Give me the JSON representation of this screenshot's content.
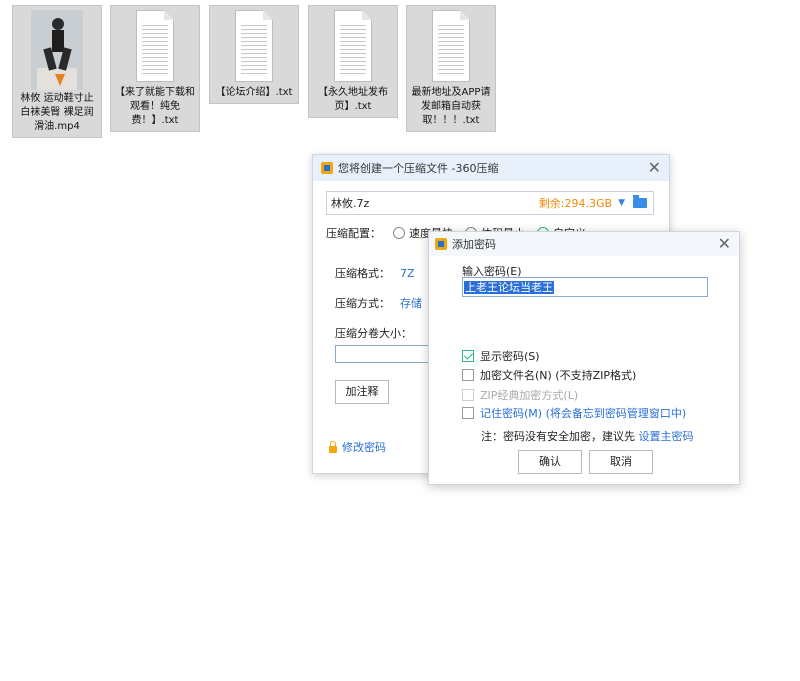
{
  "desktop": {
    "files": [
      {
        "name": "林攸 运动鞋寸止白袜美臀 裸足润滑油.mp4",
        "kind": "video"
      },
      {
        "name": "【来了就能下载和观看！纯免费！】.txt",
        "kind": "text"
      },
      {
        "name": "【论坛介绍】.txt",
        "kind": "text"
      },
      {
        "name": "【永久地址发布页】.txt",
        "kind": "text"
      },
      {
        "name": "最新地址及APP请发邮箱自动获取！！！.txt",
        "kind": "text"
      }
    ]
  },
  "compress_window": {
    "title": "您将创建一个压缩文件 -360压缩",
    "archive_name": "林攸.7z",
    "free_space": "剩余:294.3GB",
    "config_label": "压缩配置：",
    "config_options": [
      "速度最快",
      "体积最小",
      "自定义"
    ],
    "format_label": "压缩格式：",
    "format_value": "7Z",
    "method_label": "压缩方式：",
    "method_value": "存储",
    "split_label": "压缩分卷大小：",
    "comment_button": "加注释",
    "change_password": "修改密码"
  },
  "password_dialog": {
    "title": "添加密码",
    "input_label": "输入密码(E)",
    "password_value": "上老王论坛当老王",
    "options": {
      "show_password": "显示密码(S)",
      "encrypt_filenames": "加密文件名(N) (不支持ZIP格式)",
      "zip_classic": "ZIP经典加密方式(L)",
      "remember_password": "记住密码(M) (将会备忘到密码管理窗口中)"
    },
    "note_prefix": "注：密码没有安全加密，建议先",
    "note_link": "设置主密码",
    "ok_button": "确认",
    "cancel_button": "取消"
  },
  "colors": {
    "accent": "#2a6fd6",
    "free_space": "#f0890a",
    "check": "#2eb67d"
  }
}
